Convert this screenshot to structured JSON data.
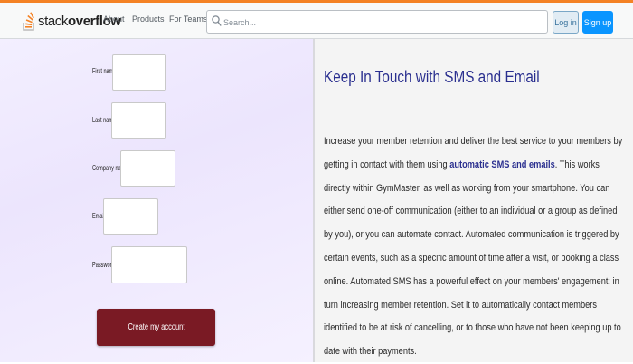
{
  "navbar": {
    "logo_light": "stack",
    "logo_bold": "overflow",
    "links": [
      "About",
      "Products",
      "For Teams"
    ],
    "search_placeholder": "Search...",
    "login_label": "Log in",
    "signup_label": "Sign up"
  },
  "form": {
    "fields": [
      {
        "label": "First name",
        "value": ""
      },
      {
        "label": "Last name",
        "value": ""
      },
      {
        "label": "Company name",
        "value": ""
      },
      {
        "label": "Email",
        "value": ""
      },
      {
        "label": "Password",
        "value": ""
      }
    ],
    "submit_label": "Create my account"
  },
  "content": {
    "heading": "Keep In Touch with SMS and Email",
    "text_before": "Increase your member retention and deliver the best service to your members by getting in contact with them using ",
    "link_text": "automatic SMS and emails",
    "text_after": ". This works directly within GymMaster, as well as working from your smartphone. You can either send one-off communication (either to an individual or a group as defined by you), or you can automate contact. Automated communication is triggered by certain events, such as a specific amount of time after a visit, or booking a class online. Automated SMS has a powerful effect on your members' engagement: in turn increasing member retention. Set it to automatically contact members identified to be at risk of cancelling, or to those who have not been keeping up to date with their payments."
  },
  "colors": {
    "accent_orange": "#f48225",
    "signup_blue": "#0a95ff",
    "heading_blue": "#2a2f8f",
    "submit_maroon": "#7a1a24"
  }
}
